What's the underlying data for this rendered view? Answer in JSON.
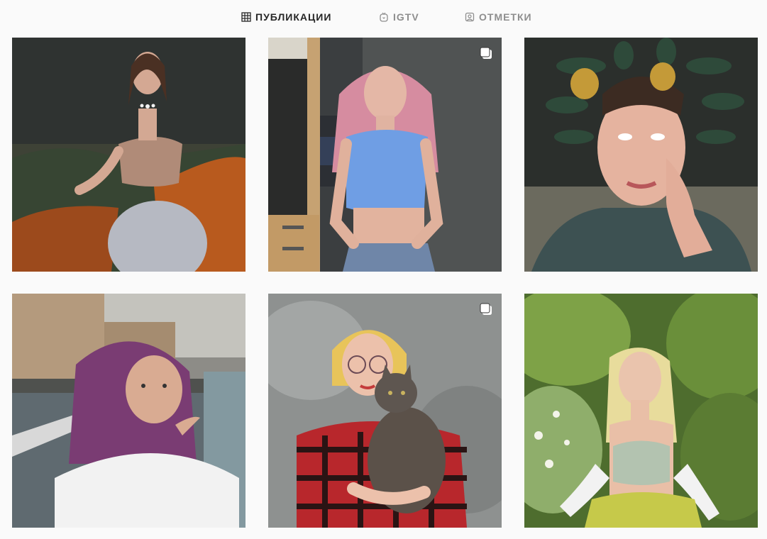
{
  "tabs": [
    {
      "label": "ПУБЛИКАЦИИ",
      "icon": "grid-icon",
      "active": true
    },
    {
      "label": "IGTV",
      "icon": "igtv-icon",
      "active": false
    },
    {
      "label": "ОТМЕТКИ",
      "icon": "tagged-user-icon",
      "active": false
    }
  ],
  "posts": [
    {
      "multi": false,
      "scene": "woman in corset top and satin skirt on couch"
    },
    {
      "multi": true,
      "scene": "woman with pink hair in blue crop top in kitchen"
    },
    {
      "multi": false,
      "scene": "person with snake headpiece selfie"
    },
    {
      "multi": false,
      "scene": "woman with purple hair blowing kiss by river"
    },
    {
      "multi": true,
      "scene": "woman with yellow hair holding cat, red plaid shirt"
    },
    {
      "multi": false,
      "scene": "blonde woman in green garden"
    }
  ],
  "colors": {
    "background": "#fafafa",
    "active_tab": "#262626",
    "inactive_tab": "#8e8e8e"
  }
}
